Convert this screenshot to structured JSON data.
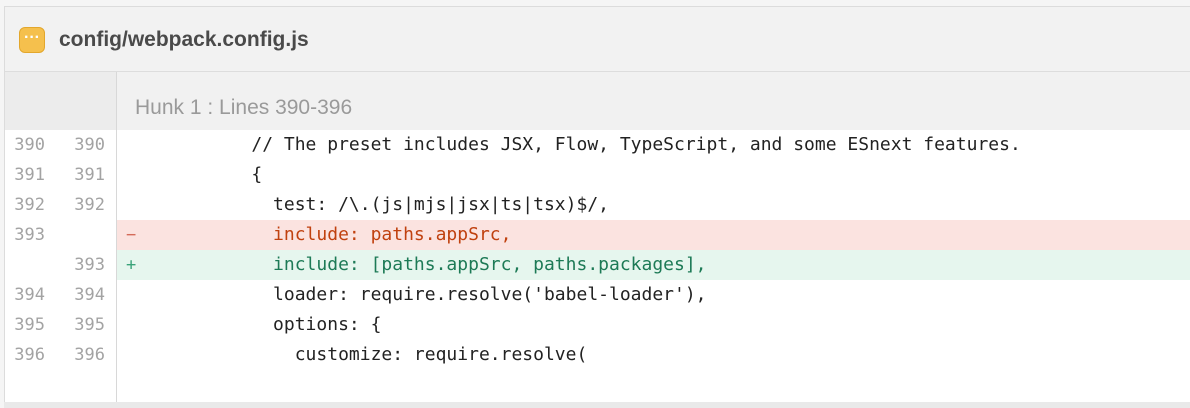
{
  "file": {
    "icon": "ellipsis-file-icon",
    "icon_glyph": "···",
    "path": "config/webpack.config.js",
    "icon_color": "#f5c04d"
  },
  "hunk": {
    "label": "Hunk 1 : Lines 390-396"
  },
  "colors": {
    "deleted_bg": "#fbe3e0",
    "deleted_text": "#c0410f",
    "added_bg": "#e6f6ee",
    "added_text": "#1d7a56"
  },
  "lines": [
    {
      "type": "context",
      "old": "390",
      "new": "390",
      "sign": "",
      "text": "          // The preset includes JSX, Flow, TypeScript, and some ESnext features."
    },
    {
      "type": "context",
      "old": "391",
      "new": "391",
      "sign": "",
      "text": "          {"
    },
    {
      "type": "context",
      "old": "392",
      "new": "392",
      "sign": "",
      "text": "            test: /\\.(js|mjs|jsx|ts|tsx)$/,"
    },
    {
      "type": "del",
      "old": "393",
      "new": "",
      "sign": "−",
      "text": "            include: paths.appSrc,"
    },
    {
      "type": "add",
      "old": "",
      "new": "393",
      "sign": "+",
      "text": "            include: [paths.appSrc, paths.packages],"
    },
    {
      "type": "context",
      "old": "394",
      "new": "394",
      "sign": "",
      "text": "            loader: require.resolve('babel-loader'),"
    },
    {
      "type": "context",
      "old": "395",
      "new": "395",
      "sign": "",
      "text": "            options: {"
    },
    {
      "type": "context",
      "old": "396",
      "new": "396",
      "sign": "",
      "text": "              customize: require.resolve("
    }
  ]
}
